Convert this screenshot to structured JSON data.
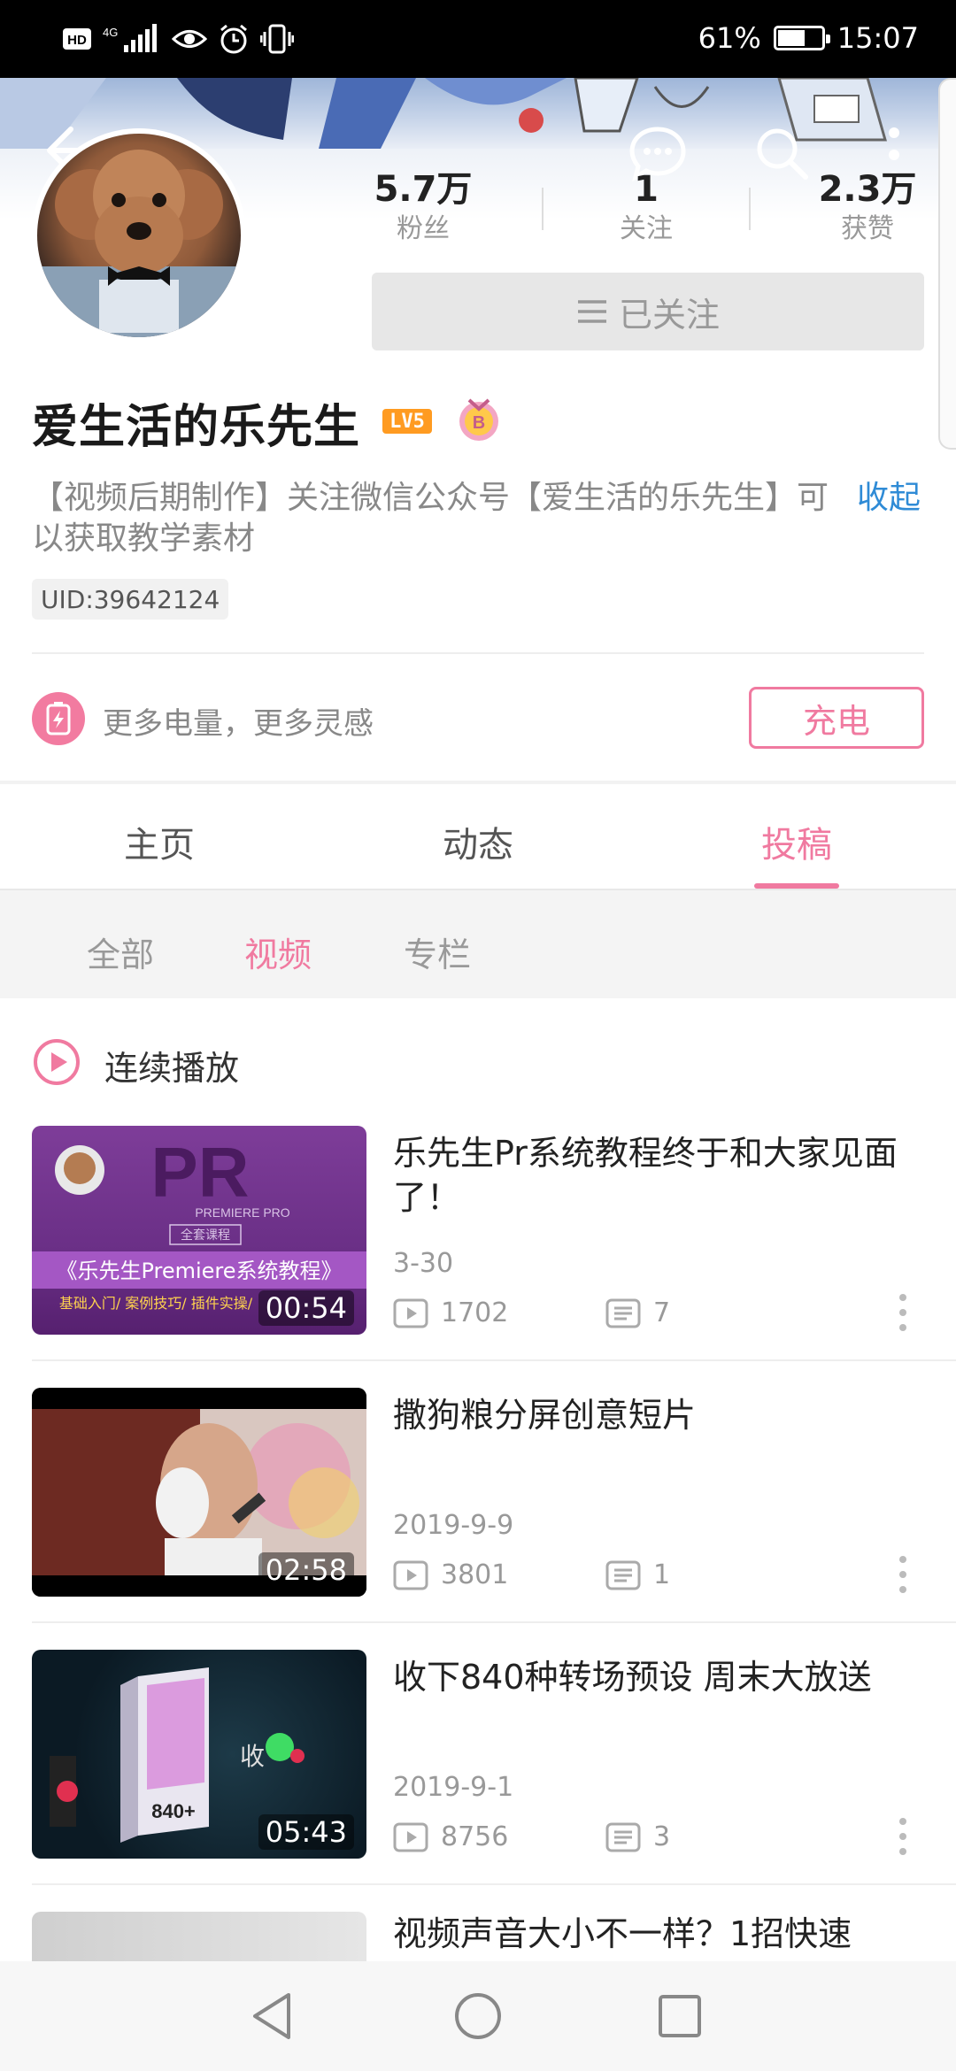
{
  "status_bar": {
    "left_icons": [
      "hd-icon",
      "4g-signal-icon",
      "eye-icon",
      "alarm-icon",
      "vibrate-icon"
    ],
    "hd_label": "HD",
    "network_label": "4G",
    "battery": "61%",
    "battery_level": 0.61,
    "time": "15:07"
  },
  "profile": {
    "stats": [
      {
        "value": "5.7万",
        "label": "粉丝"
      },
      {
        "value": "1",
        "label": "关注"
      },
      {
        "value": "2.3万",
        "label": "获赞"
      }
    ],
    "follow_label": "已关注",
    "username": "爱生活的乐先生",
    "level": "LV5",
    "medal_letter": "B",
    "bio": "【视频后期制作】关注微信公众号【爱生活的乐先生】可以获取教学素材",
    "collapse": "收起",
    "uid": "UID:39642124"
  },
  "charge": {
    "text": "更多电量，更多灵感",
    "button": "充电"
  },
  "tabs": [
    {
      "label": "主页"
    },
    {
      "label": "动态"
    },
    {
      "label": "投稿"
    }
  ],
  "subfilters": [
    {
      "label": "全部"
    },
    {
      "label": "视频"
    },
    {
      "label": "专栏"
    }
  ],
  "continuous_play": "连续播放",
  "videos": [
    {
      "title": "乐先生Pr系统教程终于和大家见面了！",
      "date": "3-30",
      "views": "1702",
      "comments": "7",
      "duration": "00:54",
      "thumb_text": {
        "logo": "PR",
        "sub": "PREMIERE PRO",
        "course": "全套课程",
        "banner": "《乐先生Premiere系统教程》",
        "tags": "基础入门/ 案例技巧/ 插件实操/"
      }
    },
    {
      "title": "撒狗粮分屏创意短片",
      "date": "2019-9-9",
      "views": "3801",
      "comments": "1",
      "duration": "02:58"
    },
    {
      "title": "收下840种转场预设 周末大放送",
      "date": "2019-9-1",
      "views": "8756",
      "comments": "3",
      "duration": "05:43",
      "thumb_text": {
        "box": "840+",
        "overlay": "收"
      }
    },
    {
      "title": "视频声音大小不一样？1招快速"
    }
  ],
  "colors": {
    "accent": "#f07aa0",
    "link": "#2f8bd6",
    "level_badge": "#ff9b21"
  }
}
